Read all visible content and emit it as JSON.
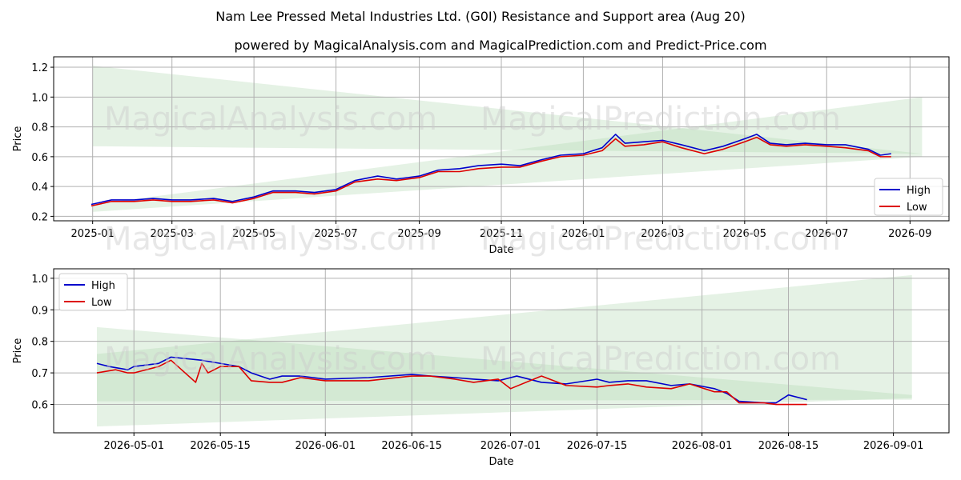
{
  "title_line1": "Nam Lee Pressed Metal Industries Ltd. (G0I) Resistance and Support area (Aug 20)",
  "title_line2": "powered by MagicalAnalysis.com and MagicalPrediction.com and Predict-Price.com",
  "watermark_left": "MagicalAnalysis.com",
  "watermark_right": "MagicalPrediction.com",
  "colors": {
    "high": "#0000cc",
    "low": "#dd0000",
    "band": "#a8d5a8"
  },
  "chart_data": [
    {
      "type": "line",
      "xlabel": "Date",
      "ylabel": "Price",
      "ylim": [
        0.17,
        1.27
      ],
      "yticks": [
        0.2,
        0.4,
        0.6,
        0.8,
        1.0,
        1.2
      ],
      "ytick_labels": [
        "0.2",
        "0.4",
        "0.6",
        "0.8",
        "1.0",
        "1.2"
      ],
      "xlim": [
        "2024-12-03",
        "2026-09-30"
      ],
      "xticks": [
        "2025-01-01",
        "2025-03-01",
        "2025-05-01",
        "2025-07-01",
        "2025-09-01",
        "2025-11-01",
        "2026-01-01",
        "2026-03-01",
        "2026-05-01",
        "2026-07-01",
        "2026-09-01"
      ],
      "xtick_labels": [
        "2025-01",
        "2025-03",
        "2025-05",
        "2025-07",
        "2025-09",
        "2025-11",
        "2026-01",
        "2026-03",
        "2026-05",
        "2026-07",
        "2026-09"
      ],
      "legend": {
        "position": "lower right",
        "entries": [
          "High",
          "Low"
        ]
      },
      "grid": true,
      "bands": [
        {
          "x": [
            "2025-01-01",
            "2026-09-10"
          ],
          "upper": [
            1.21,
            0.62
          ],
          "lower": [
            0.67,
            0.62
          ]
        },
        {
          "x": [
            "2025-01-01",
            "2026-09-10"
          ],
          "upper": [
            0.28,
            1.0
          ],
          "lower": [
            0.23,
            0.6
          ]
        }
      ],
      "series": [
        {
          "name": "High",
          "x": [
            "2024-12-31",
            "2025-01-15",
            "2025-02-01",
            "2025-02-15",
            "2025-03-01",
            "2025-03-15",
            "2025-04-01",
            "2025-04-15",
            "2025-05-01",
            "2025-05-15",
            "2025-06-01",
            "2025-06-15",
            "2025-07-01",
            "2025-07-15",
            "2025-08-01",
            "2025-08-15",
            "2025-09-01",
            "2025-09-15",
            "2025-10-01",
            "2025-10-15",
            "2025-11-01",
            "2025-11-15",
            "2025-12-01",
            "2025-12-15",
            "2026-01-01",
            "2026-01-15",
            "2026-01-25",
            "2026-02-01",
            "2026-02-15",
            "2026-03-01",
            "2026-03-15",
            "2026-04-01",
            "2026-04-15",
            "2026-05-01",
            "2026-05-10",
            "2026-05-20",
            "2026-06-01",
            "2026-06-15",
            "2026-07-01",
            "2026-07-15",
            "2026-08-01",
            "2026-08-10",
            "2026-08-18"
          ],
          "values": [
            0.28,
            0.31,
            0.31,
            0.32,
            0.31,
            0.31,
            0.32,
            0.3,
            0.33,
            0.37,
            0.37,
            0.36,
            0.38,
            0.44,
            0.47,
            0.45,
            0.47,
            0.51,
            0.52,
            0.54,
            0.55,
            0.54,
            0.58,
            0.61,
            0.62,
            0.66,
            0.75,
            0.69,
            0.7,
            0.71,
            0.68,
            0.64,
            0.67,
            0.72,
            0.75,
            0.69,
            0.68,
            0.69,
            0.68,
            0.68,
            0.65,
            0.61,
            0.62
          ]
        },
        {
          "name": "Low",
          "x": [
            "2024-12-31",
            "2025-01-15",
            "2025-02-01",
            "2025-02-15",
            "2025-03-01",
            "2025-03-15",
            "2025-04-01",
            "2025-04-15",
            "2025-05-01",
            "2025-05-15",
            "2025-06-01",
            "2025-06-15",
            "2025-07-01",
            "2025-07-15",
            "2025-08-01",
            "2025-08-15",
            "2025-09-01",
            "2025-09-15",
            "2025-10-01",
            "2025-10-15",
            "2025-11-01",
            "2025-11-15",
            "2025-12-01",
            "2025-12-15",
            "2026-01-01",
            "2026-01-15",
            "2026-01-25",
            "2026-02-01",
            "2026-02-15",
            "2026-03-01",
            "2026-03-15",
            "2026-04-01",
            "2026-04-15",
            "2026-05-01",
            "2026-05-10",
            "2026-05-20",
            "2026-06-01",
            "2026-06-15",
            "2026-07-01",
            "2026-07-15",
            "2026-08-01",
            "2026-08-10",
            "2026-08-18"
          ],
          "values": [
            0.27,
            0.3,
            0.3,
            0.31,
            0.3,
            0.3,
            0.31,
            0.29,
            0.32,
            0.36,
            0.36,
            0.35,
            0.37,
            0.43,
            0.45,
            0.44,
            0.46,
            0.5,
            0.5,
            0.52,
            0.53,
            0.53,
            0.57,
            0.6,
            0.61,
            0.64,
            0.72,
            0.67,
            0.68,
            0.7,
            0.66,
            0.62,
            0.65,
            0.7,
            0.73,
            0.68,
            0.67,
            0.68,
            0.67,
            0.66,
            0.64,
            0.6,
            0.6
          ]
        }
      ]
    },
    {
      "type": "line",
      "xlabel": "Date",
      "ylabel": "Price",
      "ylim": [
        0.51,
        1.03
      ],
      "yticks": [
        0.6,
        0.7,
        0.8,
        0.9,
        1.0
      ],
      "ytick_labels": [
        "0.6",
        "0.7",
        "0.8",
        "0.9",
        "1.0"
      ],
      "xlim": [
        "2026-04-18",
        "2026-09-10"
      ],
      "xticks": [
        "2026-05-01",
        "2026-05-15",
        "2026-06-01",
        "2026-06-15",
        "2026-07-01",
        "2026-07-15",
        "2026-08-01",
        "2026-08-15",
        "2026-09-01"
      ],
      "xtick_labels": [
        "2026-05-01",
        "2026-05-15",
        "2026-06-01",
        "2026-06-15",
        "2026-07-01",
        "2026-07-15",
        "2026-08-01",
        "2026-08-15",
        "2026-09-01"
      ],
      "legend": {
        "position": "upper left",
        "entries": [
          "High",
          "Low"
        ]
      },
      "grid": true,
      "bands": [
        {
          "x": [
            "2026-04-25",
            "2026-09-04"
          ],
          "upper": [
            0.845,
            0.63
          ],
          "lower": [
            0.61,
            0.615
          ]
        },
        {
          "x": [
            "2026-04-25",
            "2026-09-04"
          ],
          "upper": [
            0.76,
            1.01
          ],
          "lower": [
            0.53,
            0.62
          ]
        }
      ],
      "series": [
        {
          "name": "High",
          "x": [
            "2026-04-25",
            "2026-04-27",
            "2026-04-30",
            "2026-05-01",
            "2026-05-05",
            "2026-05-07",
            "2026-05-12",
            "2026-05-15",
            "2026-05-18",
            "2026-05-20",
            "2026-05-23",
            "2026-05-25",
            "2026-05-28",
            "2026-06-01",
            "2026-06-08",
            "2026-06-15",
            "2026-06-18",
            "2026-06-22",
            "2026-06-25",
            "2026-06-29",
            "2026-07-02",
            "2026-07-06",
            "2026-07-10",
            "2026-07-15",
            "2026-07-17",
            "2026-07-20",
            "2026-07-23",
            "2026-07-27",
            "2026-07-30",
            "2026-08-03",
            "2026-08-05",
            "2026-08-07",
            "2026-08-11",
            "2026-08-13",
            "2026-08-15",
            "2026-08-18"
          ],
          "values": [
            0.73,
            0.72,
            0.71,
            0.72,
            0.73,
            0.75,
            0.74,
            0.73,
            0.72,
            0.7,
            0.68,
            0.69,
            0.69,
            0.68,
            0.685,
            0.695,
            0.69,
            0.685,
            0.68,
            0.675,
            0.69,
            0.67,
            0.665,
            0.68,
            0.67,
            0.675,
            0.675,
            0.66,
            0.665,
            0.65,
            0.635,
            0.61,
            0.605,
            0.605,
            0.63,
            0.615
          ]
        },
        {
          "name": "Low",
          "x": [
            "2026-04-25",
            "2026-04-28",
            "2026-04-30",
            "2026-05-01",
            "2026-05-05",
            "2026-05-07",
            "2026-05-11",
            "2026-05-12",
            "2026-05-13",
            "2026-05-15",
            "2026-05-18",
            "2026-05-20",
            "2026-05-23",
            "2026-05-25",
            "2026-05-28",
            "2026-06-01",
            "2026-06-08",
            "2026-06-15",
            "2026-06-18",
            "2026-06-22",
            "2026-06-25",
            "2026-06-29",
            "2026-07-01",
            "2026-07-06",
            "2026-07-10",
            "2026-07-15",
            "2026-07-17",
            "2026-07-20",
            "2026-07-23",
            "2026-07-27",
            "2026-07-30",
            "2026-08-03",
            "2026-08-05",
            "2026-08-07",
            "2026-08-11",
            "2026-08-13",
            "2026-08-15",
            "2026-08-18"
          ],
          "values": [
            0.7,
            0.71,
            0.7,
            0.7,
            0.72,
            0.74,
            0.67,
            0.73,
            0.7,
            0.72,
            0.72,
            0.675,
            0.67,
            0.67,
            0.685,
            0.675,
            0.675,
            0.69,
            0.69,
            0.68,
            0.67,
            0.68,
            0.65,
            0.69,
            0.66,
            0.655,
            0.66,
            0.665,
            0.655,
            0.65,
            0.665,
            0.64,
            0.64,
            0.605,
            0.605,
            0.6,
            0.6,
            0.6
          ]
        }
      ]
    }
  ]
}
